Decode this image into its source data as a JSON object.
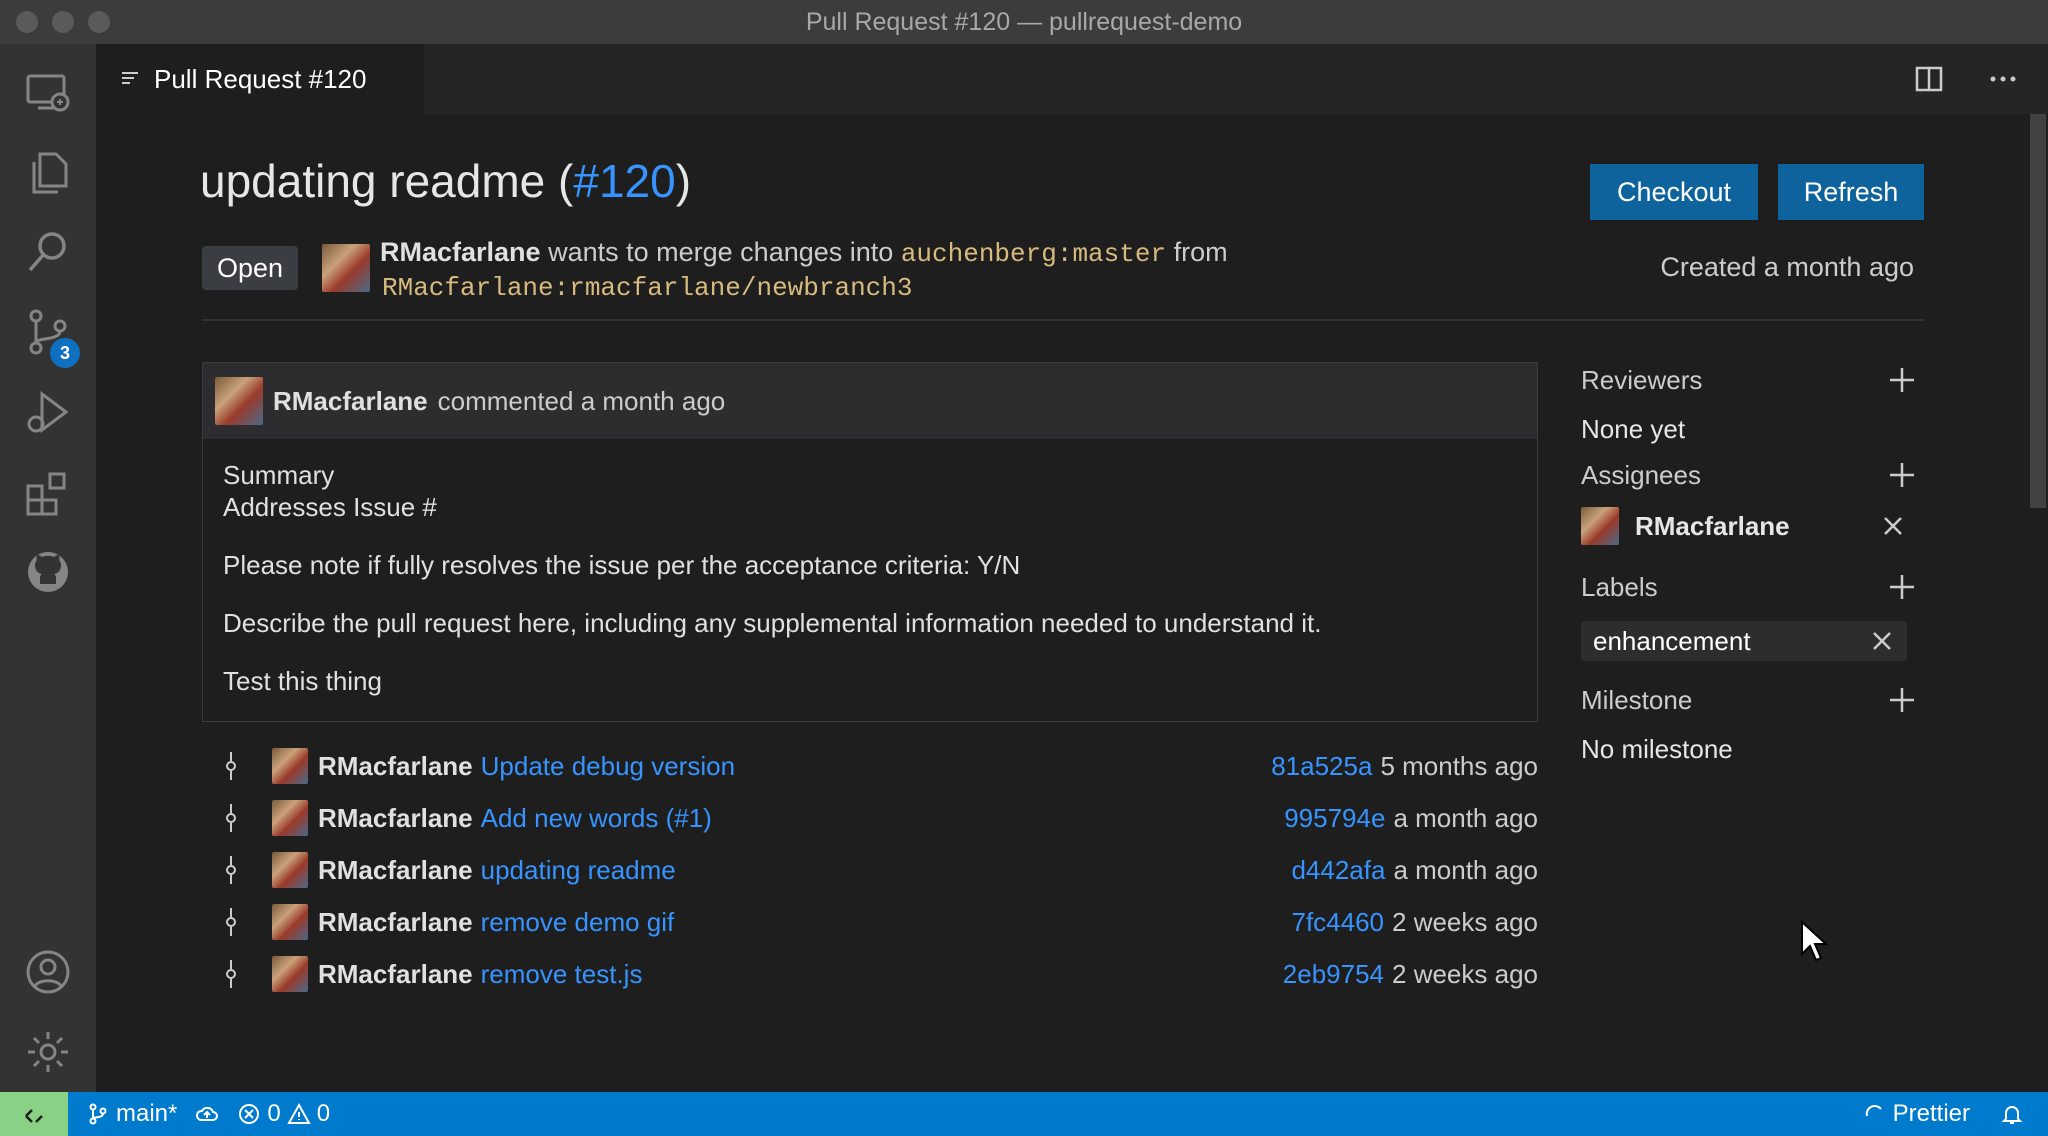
{
  "window": {
    "title": "Pull Request #120 — pullrequest-demo"
  },
  "activity_bar": {
    "scm_badge": "3"
  },
  "tab": {
    "label": "Pull Request #120"
  },
  "pr": {
    "title_text": "updating readme (",
    "number": "#120",
    "title_close": ")",
    "status": "Open",
    "author": "RMacfarlane",
    "merge_text": "wants to merge changes  into",
    "base_branch": "auchenberg:master",
    "from_text": "from",
    "head_branch": "RMacfarlane:rmacfarlane/newbranch3",
    "created": "Created a month ago",
    "checkout_label": "Checkout",
    "refresh_label": "Refresh"
  },
  "comment": {
    "author": "RMacfarlane",
    "meta": "commented a month ago",
    "lines": [
      "Summary",
      "Addresses Issue #",
      "Please note if fully resolves the issue per the acceptance criteria: Y/N",
      "Describe the pull request here, including any supplemental information needed to understand it.",
      "Test this thing"
    ]
  },
  "commits": [
    {
      "author": "RMacfarlane",
      "message": "Update debug version",
      "sha": "81a525a",
      "when": "5 months ago"
    },
    {
      "author": "RMacfarlane",
      "message": "Add new words (#1)",
      "sha": "995794e",
      "when": "a month ago"
    },
    {
      "author": "RMacfarlane",
      "message": "updating readme",
      "sha": "d442afa",
      "when": "a month ago"
    },
    {
      "author": "RMacfarlane",
      "message": "remove demo gif",
      "sha": "7fc4460",
      "when": "2 weeks ago"
    },
    {
      "author": "RMacfarlane",
      "message": "remove test.js",
      "sha": "2eb9754",
      "when": "2 weeks ago"
    }
  ],
  "sidebar": {
    "reviewers": {
      "heading": "Reviewers",
      "value": "None yet"
    },
    "assignees": {
      "heading": "Assignees",
      "name": "RMacfarlane"
    },
    "labels": {
      "heading": "Labels",
      "label": "enhancement"
    },
    "milestone": {
      "heading": "Milestone",
      "value": "No milestone"
    }
  },
  "statusbar": {
    "branch": "main*",
    "errors": "0",
    "warnings": "0",
    "prettier": "Prettier"
  },
  "colors": {
    "accent": "#007acc",
    "link": "#3794ff",
    "button": "#0e639c",
    "branch": "#d7ba7d"
  }
}
